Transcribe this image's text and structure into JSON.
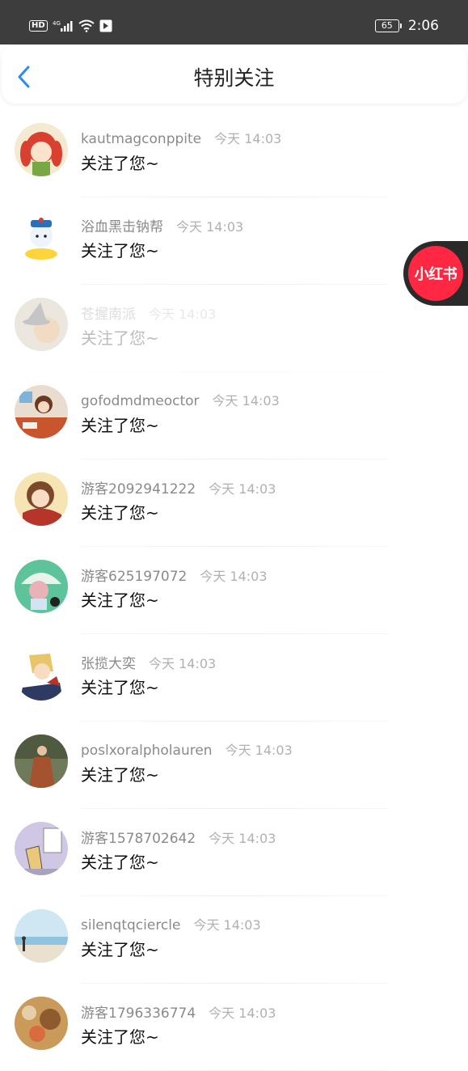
{
  "status_bar": {
    "network_badge": "HD",
    "network_type": "4G",
    "battery_level": "65",
    "time": "2:06"
  },
  "header": {
    "title": "特别关注",
    "back_icon": "chevron-left-icon"
  },
  "floating_badge": {
    "label": "小红书",
    "color": "#ff2741"
  },
  "items": [
    {
      "name": "kautmagconppite",
      "time": "今天 14:03",
      "action": "关注了您~",
      "faded": false
    },
    {
      "name": "浴血黑击钠帮",
      "time": "今天 14:03",
      "action": "关注了您~",
      "faded": false
    },
    {
      "name": "苍握南派",
      "time": "今天 14:03",
      "action": "关注了您~",
      "faded": true
    },
    {
      "name": "gofodmdmeoctor",
      "time": "今天 14:03",
      "action": "关注了您~",
      "faded": false
    },
    {
      "name": "游客2092941222",
      "time": "今天 14:03",
      "action": "关注了您~",
      "faded": false
    },
    {
      "name": "游客625197072",
      "time": "今天 14:03",
      "action": "关注了您~",
      "faded": false
    },
    {
      "name": "张揽大奕",
      "time": "今天 14:03",
      "action": "关注了您~",
      "faded": false
    },
    {
      "name": "poslxoralpholauren",
      "time": "今天 14:03",
      "action": "关注了您~",
      "faded": false
    },
    {
      "name": "游客1578702642",
      "time": "今天 14:03",
      "action": "关注了您~",
      "faded": false
    },
    {
      "name": "silenqtqciercle",
      "time": "今天 14:03",
      "action": "关注了您~",
      "faded": false
    },
    {
      "name": "游客1796336774",
      "time": "今天 14:03",
      "action": "关注了您~",
      "faded": false
    }
  ]
}
